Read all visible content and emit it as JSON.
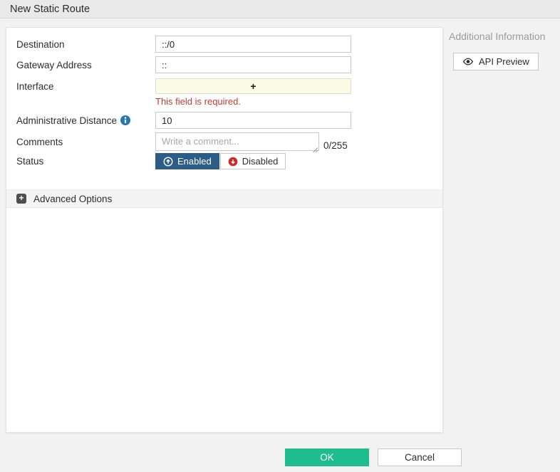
{
  "header": {
    "title": "New Static Route"
  },
  "form": {
    "fields": {
      "destination": {
        "label": "Destination",
        "value": "::/0"
      },
      "gateway": {
        "label": "Gateway Address",
        "value": "::"
      },
      "interface": {
        "label": "Interface",
        "add_glyph": "+",
        "error": "This field is required."
      },
      "admin_distance": {
        "label": "Administrative Distance",
        "value": "10",
        "info_icon": "info-icon"
      },
      "comments": {
        "label": "Comments",
        "placeholder": "Write a comment...",
        "counter": "0/255"
      },
      "status": {
        "label": "Status",
        "options": [
          {
            "label": "Enabled",
            "selected": true,
            "icon": "arrow-up-circle-icon"
          },
          {
            "label": "Disabled",
            "selected": false,
            "icon": "arrow-down-circle-icon"
          }
        ]
      }
    },
    "advanced": {
      "label": "Advanced Options",
      "expand_glyph": "+"
    }
  },
  "sidebar": {
    "title": "Additional Information",
    "api_preview_label": "API Preview",
    "api_preview_icon": "eye-icon"
  },
  "footer": {
    "ok_label": "OK",
    "cancel_label": "Cancel"
  },
  "colors": {
    "accent_green": "#1fbc8f",
    "enabled_blue": "#2b5d87",
    "disabled_red": "#cc2a27",
    "error_red": "#c53a35",
    "interface_yellow": "#fbfbe6",
    "info_blue": "#2777b8",
    "header_gray": "#e9e9e9"
  }
}
